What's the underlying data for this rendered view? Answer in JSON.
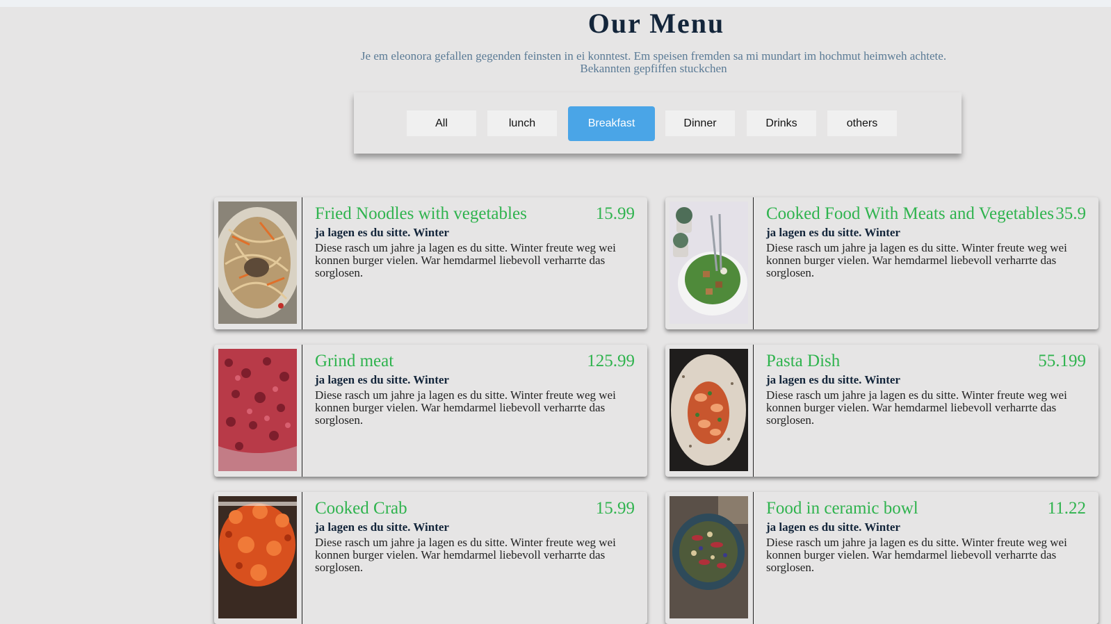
{
  "page": {
    "title": "Our Menu",
    "subtitle": "Je em eleonora gefallen gegenden feinsten in ei konntest. Em speisen fremden sa mi mundart im hochmut heimweh achtete. Bekannten gepfiffen stuckchen"
  },
  "filters": [
    {
      "label": "All",
      "active": false
    },
    {
      "label": "lunch",
      "active": false
    },
    {
      "label": "Breakfast",
      "active": true
    },
    {
      "label": "Dinner",
      "active": false
    },
    {
      "label": "Drinks",
      "active": false
    },
    {
      "label": "others",
      "active": false
    }
  ],
  "colors": {
    "accent": "#4aa5e7",
    "price": "#2fb34e",
    "heading": "#13253a",
    "background": "#e6e5e5"
  },
  "menu": [
    {
      "name": "Fried Noodles with vegetables",
      "price": "15.99",
      "subtitle": "ja lagen es du sitte. Winter",
      "description": "Diese rasch um jahre ja lagen es du sitte. Winter freute weg wei konnen burger vielen. War hemdarmel liebevoll verharrte das sorglosen.",
      "image": "fried-noodles-image"
    },
    {
      "name": "Cooked Food With Meats and Vegetables",
      "price": "35.9",
      "subtitle": "ja lagen es du sitte. Winter",
      "description": "Diese rasch um jahre ja lagen es du sitte. Winter freute weg wei konnen burger vielen. War hemdarmel liebevoll verharrte das sorglosen.",
      "image": "salad-bowl-image"
    },
    {
      "name": "Grind meat",
      "price": "125.99",
      "subtitle": "ja lagen es du sitte. Winter",
      "description": "Diese rasch um jahre ja lagen es du sitte. Winter freute weg wei konnen burger vielen. War hemdarmel liebevoll verharrte das sorglosen.",
      "image": "ground-meat-image"
    },
    {
      "name": "Pasta Dish",
      "price": "55.199",
      "subtitle": "ja lagen es du sitte. Winter",
      "description": "Diese rasch um jahre ja lagen es du sitte. Winter freute weg wei konnen burger vielen. War hemdarmel liebevoll verharrte das sorglosen.",
      "image": "pasta-dish-image"
    },
    {
      "name": "Cooked Crab",
      "price": "15.99",
      "subtitle": "ja lagen es du sitte. Winter",
      "description": "Diese rasch um jahre ja lagen es du sitte. Winter freute weg wei konnen burger vielen. War hemdarmel liebevoll verharrte das sorglosen.",
      "image": "cooked-crab-image"
    },
    {
      "name": "Food in ceramic bowl",
      "price": "11.22",
      "subtitle": "ja lagen es du sitte. Winter",
      "description": "Diese rasch um jahre ja lagen es du sitte. Winter freute weg wei konnen burger vielen. War hemdarmel liebevoll verharrte das sorglosen.",
      "image": "ceramic-bowl-image"
    }
  ]
}
